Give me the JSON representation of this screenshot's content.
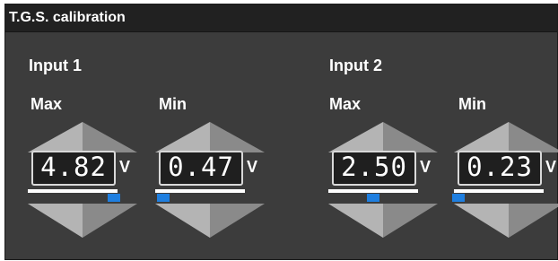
{
  "window": {
    "title": "T.G.S. calibration"
  },
  "inputs": [
    {
      "label": "Input 1",
      "max": {
        "label": "Max",
        "value": "4.82",
        "unit": "V",
        "level": 0.96
      },
      "min": {
        "label": "Min",
        "value": "0.47",
        "unit": "V",
        "level": 0.09
      }
    },
    {
      "label": "Input 2",
      "max": {
        "label": "Max",
        "value": "2.50",
        "unit": "V",
        "level": 0.5
      },
      "min": {
        "label": "Min",
        "value": "0.23",
        "unit": "V",
        "level": 0.05
      }
    }
  ],
  "colors": {
    "panel": "#3c3c3c",
    "titlebar": "#212121",
    "display": "#1f1f1f",
    "slider_thumb": "#1f7fe0",
    "text": "#ffffff"
  },
  "icons": {
    "increase": "up-arrow-icon",
    "decrease": "down-arrow-icon"
  }
}
